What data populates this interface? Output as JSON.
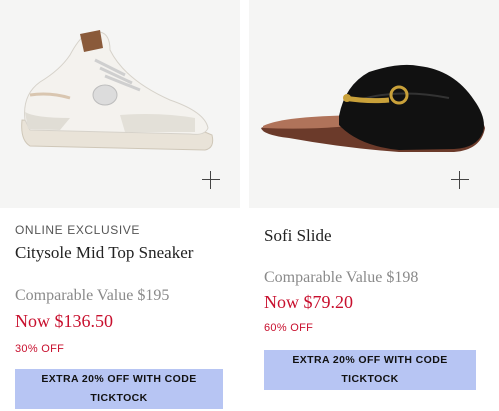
{
  "products": [
    {
      "badge": "ONLINE EXCLUSIVE",
      "name": "Citysole Mid Top Sneaker",
      "comparable": "Comparable Value $195",
      "now": "Now $136.50",
      "discount": "30% OFF",
      "promo_line1": "EXTRA 20% OFF WITH CODE",
      "promo_line2": "TICKTOCK",
      "image": "sneaker-image"
    },
    {
      "badge": "",
      "name": "Sofi Slide",
      "comparable": "Comparable Value $198",
      "now": "Now $79.20",
      "discount": "60% OFF",
      "promo_line1": "EXTRA 20% OFF WITH CODE",
      "promo_line2": "TICKTOCK",
      "image": "slide-image"
    }
  ],
  "colors": {
    "sale_red": "#c8102e",
    "promo_blue": "#b7c5f3",
    "image_bg": "#f5f5f4"
  },
  "icons": {
    "add": "plus-icon"
  }
}
